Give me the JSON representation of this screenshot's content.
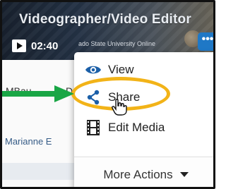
{
  "video": {
    "title": "Videographer/Video Editor",
    "duration": "02:40",
    "subtitle": "ado State University Online",
    "more_button": "•••"
  },
  "page": {
    "text_1": "MBau",
    "text_1_right": "D",
    "author": "Marianne E"
  },
  "menu": {
    "items": [
      {
        "label": "View",
        "icon": "eye-icon"
      },
      {
        "label": "Share",
        "icon": "share-icon"
      },
      {
        "label": "Edit Media",
        "icon": "film-icon"
      }
    ],
    "more_actions": "More Actions"
  },
  "colors": {
    "accent_blue": "#1f78c6",
    "highlight": "#f2b318",
    "arrow_green": "#19a645"
  }
}
